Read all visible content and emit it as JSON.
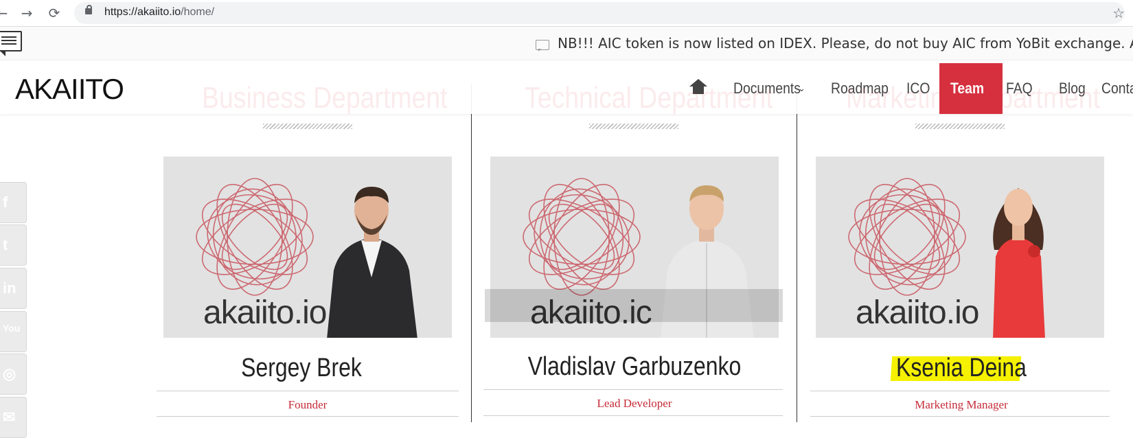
{
  "browser": {
    "back_glyph": "←",
    "forward_glyph": "→",
    "reload_glyph": "⟳",
    "url_host": "https://akaiito.io",
    "url_path": "/home/",
    "star_glyph": "☆"
  },
  "announcement": {
    "text": "NB!!! AIC token is now listed on IDEX. Please, do not buy AIC from YoBit exchange. Aka"
  },
  "site": {
    "logo": "AKAIITO"
  },
  "nav": {
    "items": [
      {
        "label": "Documents",
        "has_dropdown": true
      },
      {
        "label": "Roadmap"
      },
      {
        "label": "ICO"
      },
      {
        "label": "Team",
        "active": true
      },
      {
        "label": "FAQ"
      },
      {
        "label": "Blog"
      },
      {
        "label": "Conta"
      }
    ],
    "dropdown_glyph": "⌄"
  },
  "departments": [
    {
      "title": "Business Department"
    },
    {
      "title": "Technical Department"
    },
    {
      "title": "Marketing Department"
    }
  ],
  "social_icons": [
    "facebook-icon",
    "twitter-icon",
    "linkedin-icon",
    "youtube-icon",
    "instagram-icon",
    "email-icon"
  ],
  "social_glyphs": [
    "f",
    "t",
    "in",
    "You",
    "◎",
    "✉"
  ],
  "team": [
    {
      "photo_brand": "akaiito.io",
      "name": "Sergey Brek",
      "role": "Founder"
    },
    {
      "photo_brand": "akaiito.ic",
      "name": "Vladislav Garbuzenko",
      "role": "Lead Developer"
    },
    {
      "photo_brand": "akaiito.io",
      "name": "Ksenia Deina",
      "role": "Marketing Manager"
    }
  ],
  "colors": {
    "accent": "#d6303f",
    "highlight": "#f5f100",
    "photo_bg": "#e2e2e2"
  }
}
